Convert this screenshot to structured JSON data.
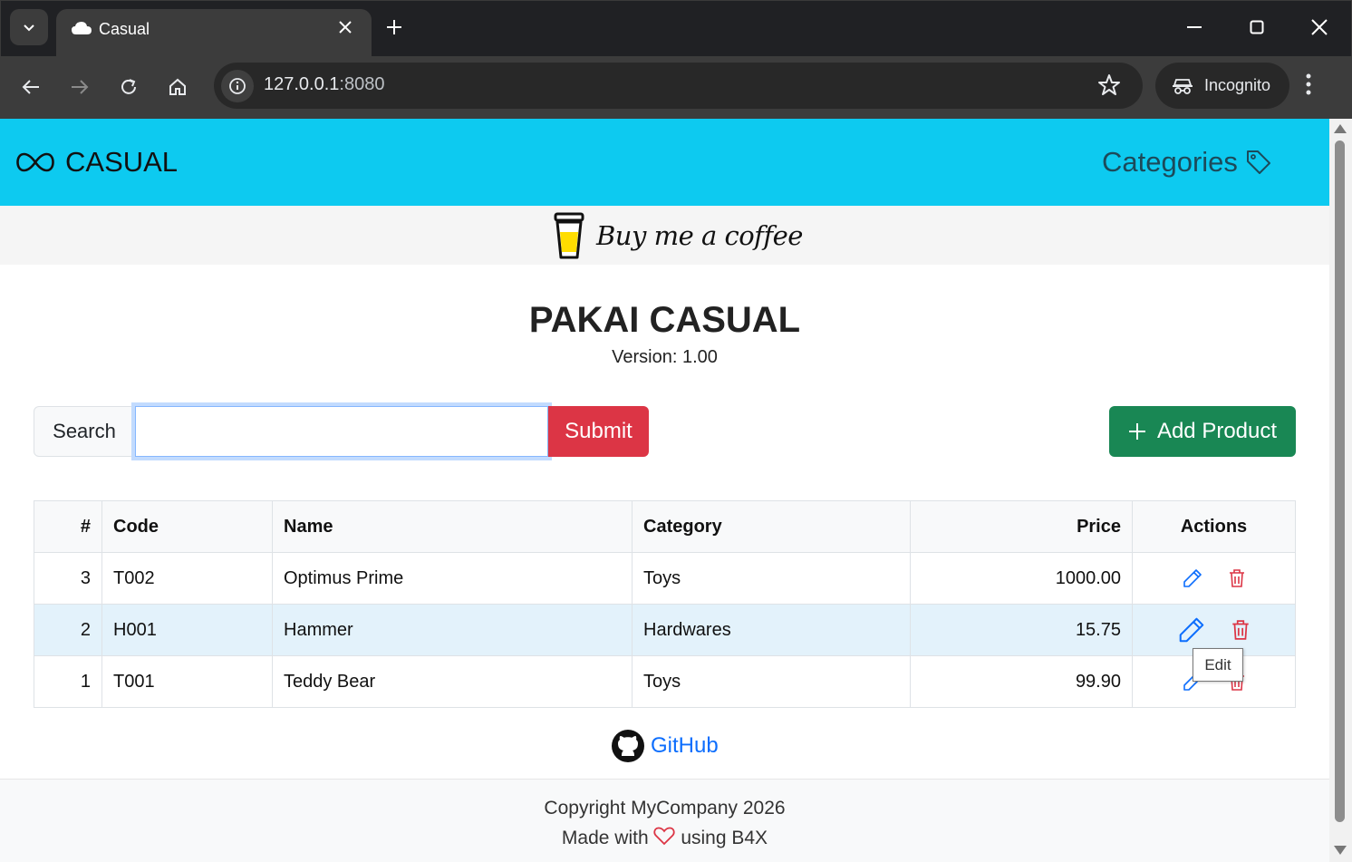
{
  "browser": {
    "tab_title": "Casual",
    "url_host": "127.0.0.1",
    "url_port": ":8080",
    "incognito_label": "Incognito"
  },
  "navbar": {
    "brand": "CASUAL",
    "categories": "Categories",
    "color": "#0dcaf0"
  },
  "coffee": {
    "label": "Buy me a coffee"
  },
  "header": {
    "title": "PAKAI CASUAL",
    "version": "Version: 1.00"
  },
  "search": {
    "label": "Search",
    "value": "",
    "submit": "Submit"
  },
  "add_product": "Add Product",
  "table": {
    "columns": [
      "#",
      "Code",
      "Name",
      "Category",
      "Price",
      "Actions"
    ],
    "rows": [
      {
        "id": "3",
        "code": "T002",
        "name": "Optimus Prime",
        "category": "Toys",
        "price": "1000.00"
      },
      {
        "id": "2",
        "code": "H001",
        "name": "Hammer",
        "category": "Hardwares",
        "price": "15.75"
      },
      {
        "id": "1",
        "code": "T001",
        "name": "Teddy Bear",
        "category": "Toys",
        "price": "99.90"
      }
    ]
  },
  "tooltip": "Edit",
  "github": "GitHub",
  "footer": {
    "copyright": "Copyright MyCompany 2026",
    "made_with_prefix": "Made with",
    "made_with_suffix": "using B4X"
  },
  "colors": {
    "danger": "#dc3545",
    "success": "#198754",
    "primary": "#0d6efd"
  }
}
